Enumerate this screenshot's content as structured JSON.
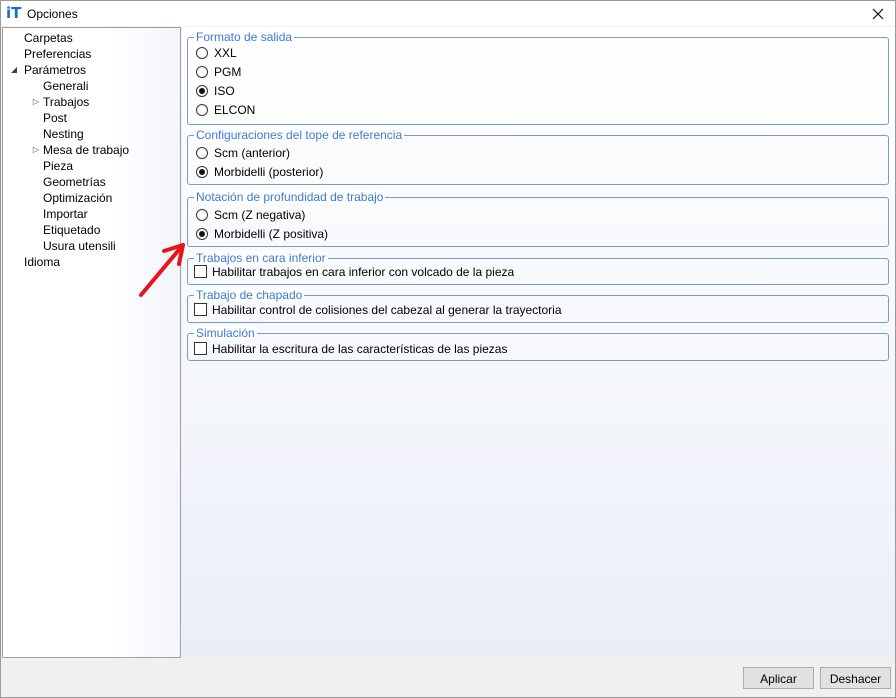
{
  "window": {
    "title": "Opciones",
    "icon": "it-logo-icon"
  },
  "tree": {
    "items": [
      {
        "label": "Carpetas",
        "level": 0,
        "toggle": ""
      },
      {
        "label": "Preferencias",
        "level": 0,
        "toggle": ""
      },
      {
        "label": "Parámetros",
        "level": 0,
        "toggle": "◢"
      },
      {
        "label": "Generali",
        "level": 1,
        "toggle": ""
      },
      {
        "label": "Trabajos",
        "level": 1,
        "toggle": "▷"
      },
      {
        "label": "Post",
        "level": 1,
        "toggle": ""
      },
      {
        "label": "Nesting",
        "level": 1,
        "toggle": ""
      },
      {
        "label": "Mesa de trabajo",
        "level": 1,
        "toggle": "▷"
      },
      {
        "label": "Pieza",
        "level": 1,
        "toggle": ""
      },
      {
        "label": "Geometrías",
        "level": 1,
        "toggle": ""
      },
      {
        "label": "Optimización",
        "level": 1,
        "toggle": ""
      },
      {
        "label": "Importar",
        "level": 1,
        "toggle": ""
      },
      {
        "label": "Etiquetado",
        "level": 1,
        "toggle": ""
      },
      {
        "label": "Usura utensili",
        "level": 1,
        "toggle": ""
      },
      {
        "label": "Idioma",
        "level": 0,
        "toggle": ""
      }
    ]
  },
  "groups": {
    "output_format": {
      "title": "Formato de salida",
      "options": [
        {
          "label": "XXL",
          "selected": false
        },
        {
          "label": "PGM",
          "selected": false
        },
        {
          "label": "ISO",
          "selected": true
        },
        {
          "label": "ELCON",
          "selected": false
        }
      ]
    },
    "reference_stop": {
      "title": "Configuraciones del tope de referencia",
      "options": [
        {
          "label": "Scm (anterior)",
          "selected": false
        },
        {
          "label": "Morbidelli (posterior)",
          "selected": true
        }
      ]
    },
    "depth_notation": {
      "title": "Notación de profundidad de trabajo",
      "options": [
        {
          "label": "Scm (Z negativa)",
          "selected": false
        },
        {
          "label": "Morbidelli (Z positiva)",
          "selected": true
        }
      ]
    },
    "bottom_face": {
      "title": "Trabajos en cara inferior",
      "checkbox": {
        "label": "Habilitar trabajos en cara inferior con volcado de la pieza",
        "checked": false
      }
    },
    "edgebanding": {
      "title": "Trabajo de chapado",
      "checkbox": {
        "label": "Habilitar control de colisiones del cabezal al generar la trayectoria",
        "checked": false
      }
    },
    "simulation": {
      "title": "Simulación",
      "checkbox": {
        "label": "Habilitar la escritura de las características de las piezas",
        "checked": false
      }
    }
  },
  "buttons": {
    "apply": "Aplicar",
    "undo": "Deshacer"
  },
  "annotation": {
    "arrow_color": "#e8141b"
  },
  "colors": {
    "group_title": "#3a7bd5",
    "group_border": "#7a9cc6"
  }
}
